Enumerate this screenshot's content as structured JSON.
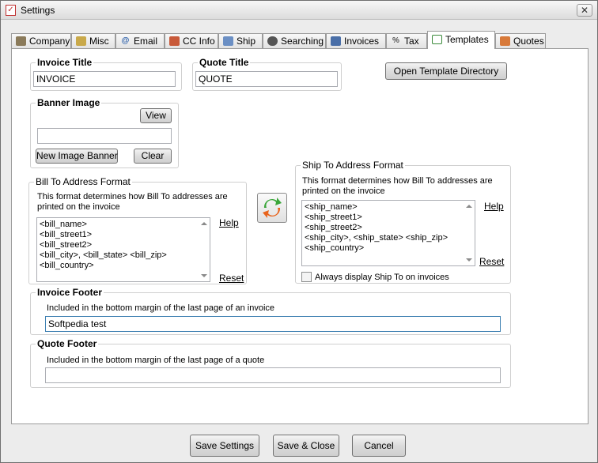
{
  "window": {
    "title": "Settings"
  },
  "tabs": [
    {
      "label": "Company",
      "icon": "company-icon"
    },
    {
      "label": "Misc",
      "icon": "misc-icon"
    },
    {
      "label": "Email",
      "icon": "email-icon"
    },
    {
      "label": "CC Info",
      "icon": "credit-card-icon"
    },
    {
      "label": "Ship",
      "icon": "ship-icon"
    },
    {
      "label": "Searching",
      "icon": "binoculars-icon"
    },
    {
      "label": "Invoices",
      "icon": "invoices-icon"
    },
    {
      "label": "Tax",
      "icon": "tax-icon"
    },
    {
      "label": "Templates",
      "icon": "document-icon"
    },
    {
      "label": "Quotes",
      "icon": "quotes-icon"
    }
  ],
  "active_tab": "Templates",
  "templates": {
    "invoice_title": {
      "label": "Invoice Title",
      "value": "INVOICE"
    },
    "quote_title": {
      "label": "Quote Title",
      "value": "QUOTE"
    },
    "open_dir_button": "Open Template Directory",
    "banner": {
      "label": "Banner Image",
      "view_button": "View",
      "path_value": "",
      "new_button": "New Image Banner",
      "clear_button": "Clear"
    },
    "bill_to": {
      "label": "Bill To Address Format",
      "desc_line1": "This format determines how Bill To addresses are",
      "desc_line2": "printed on the invoice",
      "lines": [
        "<bill_name>",
        "<bill_street1>",
        "<bill_street2>",
        "<bill_city>, <bill_state> <bill_zip>",
        "<bill_country>"
      ],
      "help": "Help",
      "reset": "Reset"
    },
    "ship_to": {
      "label": "Ship To Address Format",
      "desc_line1": "This format determines how Bill To addresses are",
      "desc_line2": "printed on the invoice",
      "lines": [
        "<ship_name>",
        "<ship_street1>",
        "<ship_street2>",
        "<ship_city>, <ship_state> <ship_zip>",
        "<ship_country>"
      ],
      "help": "Help",
      "reset": "Reset",
      "always_display": {
        "label": "Always display Ship To on invoices",
        "checked": false
      }
    },
    "invoice_footer": {
      "label": "Invoice Footer",
      "desc": "Included in the bottom margin of the last page of an invoice",
      "value": "Softpedia test"
    },
    "quote_footer": {
      "label": "Quote Footer",
      "desc": "Included in the bottom margin of the last page of a quote",
      "value": ""
    }
  },
  "buttons": {
    "save_settings": "Save Settings",
    "save_close": "Save & Close",
    "cancel": "Cancel"
  },
  "colors": {
    "accent": "#3c7fb1",
    "swap_green": "#3aa63a",
    "swap_orange": "#e8641c"
  }
}
